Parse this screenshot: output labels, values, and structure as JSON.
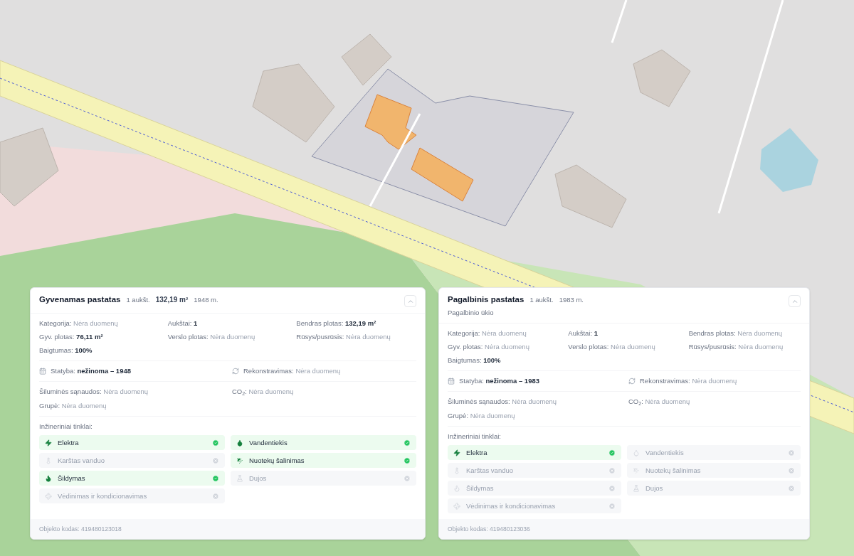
{
  "cards": [
    {
      "title": "Gyvenamas pastatas",
      "meta": [
        {
          "text": "1 aukšt.",
          "emphasis": false
        },
        {
          "text": "132,19 m²",
          "emphasis": true
        },
        {
          "text": "1948 m.",
          "emphasis": false
        }
      ],
      "expanded": true,
      "details": [
        {
          "label": "Kategorija:",
          "value": "Nėra duomenų",
          "filled": false
        },
        {
          "label": "Aukštai:",
          "value": "1",
          "filled": true
        },
        {
          "label": "Bendras plotas:",
          "value": "132,19 m²",
          "filled": true
        },
        {
          "label": "Gyv. plotas:",
          "value": "76,11 m²",
          "filled": true
        },
        {
          "label": "Verslo plotas:",
          "value": "Nėra duomenų",
          "filled": false
        },
        {
          "label": "Rūsys/pusrūsis:",
          "value": "Nėra duomenų",
          "filled": false
        },
        {
          "label": "Baigtumas:",
          "value": "100%",
          "filled": true
        }
      ],
      "construction": [
        {
          "kind": "built",
          "label": "Statyba:",
          "value": "nežinoma – 1948",
          "filled": true
        },
        {
          "kind": "rebuilt",
          "label": "Rekonstravimas:",
          "value": "Nėra duomenų",
          "filled": false
        }
      ],
      "energy": [
        {
          "label": "Šiluminės sąnaudos:",
          "value": "Nėra duomenų",
          "filled": false
        },
        {
          "label": "CO$_{2}$:",
          "value": "Nėra duomenų",
          "filled": false
        },
        {
          "label": "Grupė:",
          "value": "Nėra duomenų",
          "filled": false
        }
      ],
      "utilities_title": "Inžineriniai tinklai:",
      "utilities": [
        {
          "kind": "power",
          "name": "Elektra",
          "connected": true
        },
        {
          "kind": "water",
          "name": "Vandentiekis",
          "connected": true
        },
        {
          "kind": "hotwater",
          "name": "Karštas vanduo",
          "connected": false
        },
        {
          "kind": "sewer",
          "name": "Nuotekų šalinimas",
          "connected": true
        },
        {
          "kind": "heat",
          "name": "Šildymas",
          "connected": true
        },
        {
          "kind": "gas",
          "name": "Dujos",
          "connected": false
        },
        {
          "kind": "air",
          "name": "Vėdinimas ir kondicionavimas",
          "connected": false
        }
      ],
      "code": "Objekto kodas: 419480123018"
    },
    {
      "title": "Pagalbinis pastatas",
      "meta": [
        {
          "text": "1 aukšt.",
          "emphasis": false
        },
        {
          "text": "1983 m.",
          "emphasis": false
        }
      ],
      "subtitle": "Pagalbinio ūkio",
      "expanded": true,
      "details": [
        {
          "label": "Kategorija:",
          "value": "Nėra duomenų",
          "filled": false
        },
        {
          "label": "Aukštai:",
          "value": "1",
          "filled": true
        },
        {
          "label": "Bendras plotas:",
          "value": "Nėra duomenų",
          "filled": false
        },
        {
          "label": "Gyv. plotas:",
          "value": "Nėra duomenų",
          "filled": false
        },
        {
          "label": "Verslo plotas:",
          "value": "Nėra duomenų",
          "filled": false
        },
        {
          "label": "Rūsys/pusrūsis:",
          "value": "Nėra duomenų",
          "filled": false
        },
        {
          "label": "Baigtumas:",
          "value": "100%",
          "filled": true
        }
      ],
      "construction": [
        {
          "kind": "built",
          "label": "Statyba:",
          "value": "nežinoma – 1983",
          "filled": true
        },
        {
          "kind": "rebuilt",
          "label": "Rekonstravimas:",
          "value": "Nėra duomenų",
          "filled": false
        }
      ],
      "energy": [
        {
          "label": "Šiluminės sąnaudos:",
          "value": "Nėra duomenų",
          "filled": false
        },
        {
          "label": "CO$_{2}$:",
          "value": "Nėra duomenų",
          "filled": false
        },
        {
          "label": "Grupė:",
          "value": "Nėra duomenų",
          "filled": false
        }
      ],
      "utilities_title": "Inžineriniai tinklai:",
      "utilities": [
        {
          "kind": "power",
          "name": "Elektra",
          "connected": true
        },
        {
          "kind": "water",
          "name": "Vandentiekis",
          "connected": false
        },
        {
          "kind": "hotwater",
          "name": "Karštas vanduo",
          "connected": false
        },
        {
          "kind": "sewer",
          "name": "Nuotekų šalinimas",
          "connected": false
        },
        {
          "kind": "heat",
          "name": "Šildymas",
          "connected": false
        },
        {
          "kind": "gas",
          "name": "Dujos",
          "connected": false
        },
        {
          "kind": "air",
          "name": "Vėdinimas ir kondicionavimas",
          "connected": false
        }
      ],
      "code": "Objekto kodas: 419480123036"
    }
  ]
}
